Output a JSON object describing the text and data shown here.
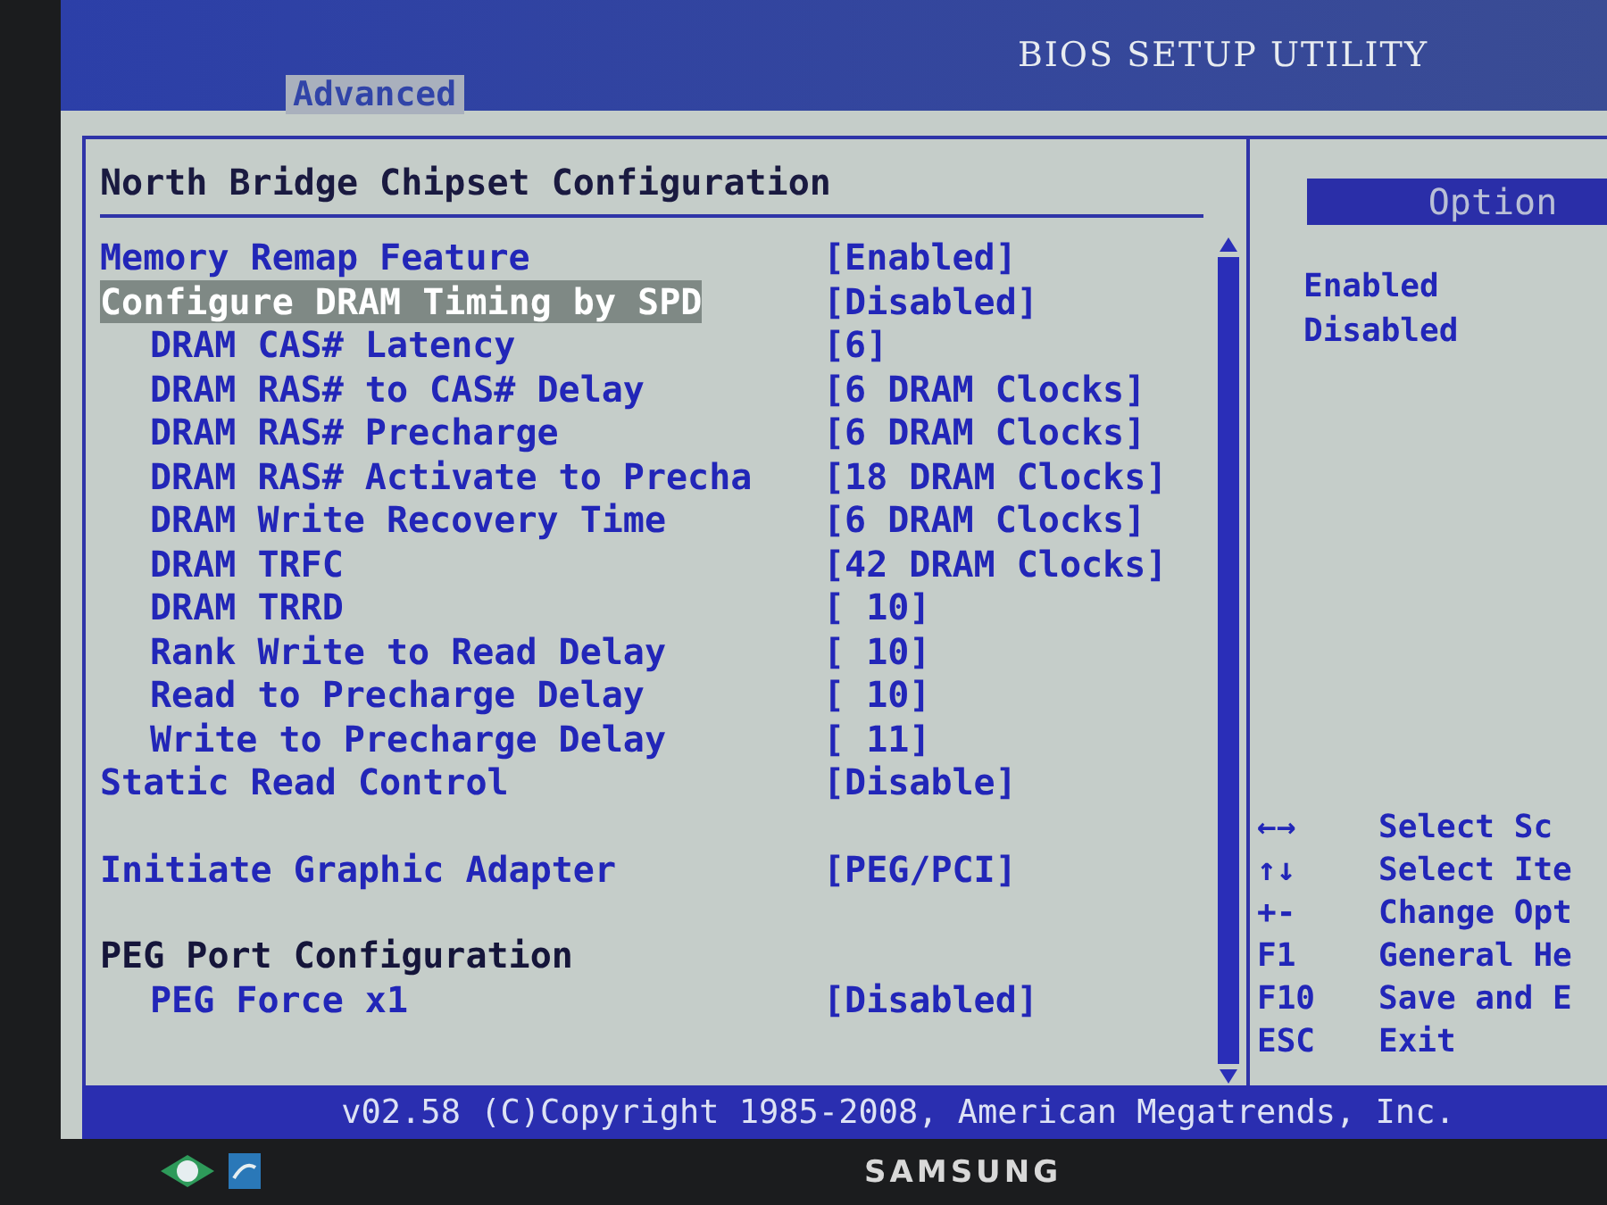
{
  "header": {
    "title": "BIOS SETUP UTILITY",
    "tabs": [
      {
        "label": "Advanced",
        "selected": true
      }
    ]
  },
  "main": {
    "title": "North Bridge Chipset Configuration",
    "sections": [
      {
        "items": [
          {
            "kind": "setting",
            "label": "Memory Remap Feature",
            "value": "[Enabled]",
            "selected": false
          },
          {
            "kind": "setting",
            "label": "Configure DRAM Timing by SPD",
            "value": "[Disabled]",
            "selected": true,
            "children": [
              {
                "kind": "setting",
                "label": "DRAM CAS# Latency",
                "value": "[6]",
                "selected": false
              },
              {
                "kind": "setting",
                "label": "DRAM RAS# to CAS# Delay",
                "value": "[6 DRAM Clocks]",
                "selected": false
              },
              {
                "kind": "setting",
                "label": "DRAM RAS# Precharge",
                "value": "[6 DRAM Clocks]",
                "selected": false
              },
              {
                "kind": "setting",
                "label": "DRAM RAS# Activate to Precha",
                "value": "[18 DRAM Clocks]",
                "selected": false
              },
              {
                "kind": "setting",
                "label": "DRAM Write Recovery Time",
                "value": "[6 DRAM Clocks]",
                "selected": false
              },
              {
                "kind": "setting",
                "label": "DRAM TRFC",
                "value": "[42 DRAM Clocks]",
                "selected": false
              },
              {
                "kind": "setting",
                "label": "DRAM TRRD",
                "value": "[ 10]",
                "selected": false
              },
              {
                "kind": "setting",
                "label": "Rank Write to Read Delay",
                "value": "[ 10]",
                "selected": false
              },
              {
                "kind": "setting",
                "label": "Read to Precharge Delay",
                "value": "[ 10]",
                "selected": false
              },
              {
                "kind": "setting",
                "label": "Write to Precharge Delay",
                "value": "[ 11]",
                "selected": false
              }
            ]
          },
          {
            "kind": "setting",
            "label": "Static Read Control",
            "value": "[Disable]",
            "selected": false
          }
        ]
      },
      {
        "items": [
          {
            "kind": "setting",
            "label": "Initiate Graphic Adapter",
            "value": "[PEG/PCI]",
            "selected": false
          }
        ]
      },
      {
        "items": [
          {
            "kind": "heading",
            "label": "PEG Port Configuration",
            "children": [
              {
                "kind": "setting",
                "label": "PEG Force x1",
                "value": "[Disabled]",
                "selected": false
              }
            ]
          }
        ]
      }
    ]
  },
  "help": {
    "title": "Option",
    "options": [
      "Enabled",
      "Disabled"
    ],
    "keys": [
      {
        "key": "←→",
        "action": "Select Sc"
      },
      {
        "key": "↑↓",
        "action": "Select Ite"
      },
      {
        "key": "+-",
        "action": "Change Opt"
      },
      {
        "key": "F1",
        "action": "General He"
      },
      {
        "key": "F10",
        "action": "Save and E"
      },
      {
        "key": "ESC",
        "action": "Exit"
      }
    ]
  },
  "footer": {
    "text": "v02.58 (C)Copyright 1985-2008, American Megatrends, Inc."
  },
  "monitor": {
    "brand": "SAMSUNG"
  }
}
